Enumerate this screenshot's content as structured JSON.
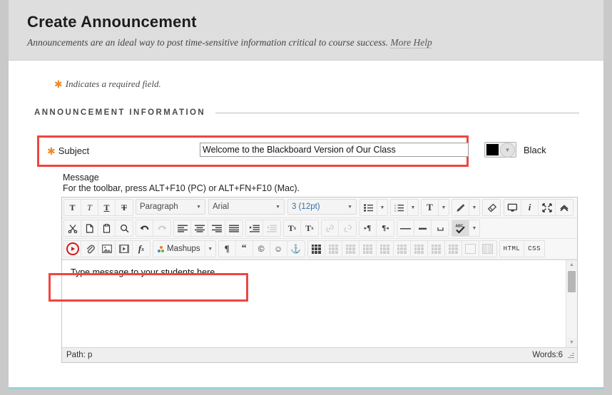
{
  "header": {
    "title": "Create Announcement",
    "description": "Announcements are an ideal way to post time-sensitive information critical to course success.",
    "more_help": "More Help"
  },
  "required_note": {
    "asterisk": "✱",
    "text": "Indicates a required field."
  },
  "section": {
    "title": "ANNOUNCEMENT INFORMATION"
  },
  "subject": {
    "asterisk": "✱",
    "label": "Subject",
    "value": "Welcome to the Blackboard Version of Our Class",
    "placeholder": "",
    "color_name": "Black",
    "color_hex": "#000000"
  },
  "message": {
    "label": "Message",
    "hint": "For the toolbar, press ALT+F10 (PC) or ALT+FN+F10 (Mac).",
    "content": "Type message to your students here",
    "content_dots": ".........",
    "status_path": "Path: p",
    "status_words": "Words:6"
  },
  "toolbar": {
    "row1": {
      "bold": "T",
      "italic": "T",
      "underline": "T",
      "strikethrough": "T",
      "paragraph_select": "Paragraph",
      "font_select": "Arial",
      "size_select": "3 (12pt)",
      "bullet_list": "•≡",
      "numbered_list": "≡",
      "text_color": "T",
      "highlight": "pen",
      "remove_format": "eraser"
    },
    "row1_right": {
      "preview": "monitor",
      "info": "i",
      "fullscreen": "expand",
      "collapse": "chevron-up"
    },
    "row2": {
      "cut": "✄",
      "copy": "copy",
      "paste": "paste",
      "find": "search",
      "undo": "undo",
      "redo": "redo",
      "align_left": "align-left",
      "align_center": "align-center",
      "align_right": "align-right",
      "align_justify": "align-justify",
      "indent": "indent",
      "outdent": "outdent",
      "superscript": "Tx",
      "subscript": "Tx",
      "link": "link",
      "unlink": "unlink",
      "ltr": "¶",
      "rtl": "¶",
      "hr": "—",
      "emdash": "—",
      "nbsp": "␣",
      "spellcheck": "ABC",
      "spellcheck_label": "ABC"
    },
    "row3": {
      "record": "record",
      "attach": "paperclip",
      "image": "image",
      "video": "film",
      "formula": "fx",
      "mashups": "Mashups",
      "pilcrow": "¶",
      "quote": "“",
      "copyright": "©",
      "emoji": "☺",
      "anchor": "⚓",
      "table": "table",
      "html_button": "HTML",
      "css_button": "CSS"
    }
  }
}
